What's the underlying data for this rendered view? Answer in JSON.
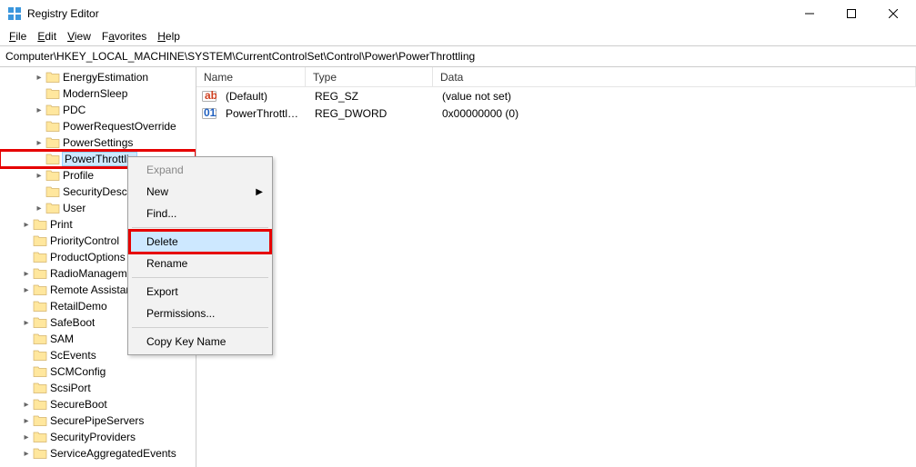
{
  "window": {
    "title": "Registry Editor",
    "icon": "registry-app-icon"
  },
  "menubar": [
    {
      "label": "File",
      "accel": "F"
    },
    {
      "label": "Edit",
      "accel": "E"
    },
    {
      "label": "View",
      "accel": "V"
    },
    {
      "label": "Favorites",
      "accel": "a"
    },
    {
      "label": "Help",
      "accel": "H"
    }
  ],
  "address": "Computer\\HKEY_LOCAL_MACHINE\\SYSTEM\\CurrentControlSet\\Control\\Power\\PowerThrottling",
  "tree": [
    {
      "level": 3,
      "expando": ">",
      "label": "EnergyEstimation"
    },
    {
      "level": 3,
      "expando": "",
      "label": "ModernSleep"
    },
    {
      "level": 3,
      "expando": ">",
      "label": "PDC"
    },
    {
      "level": 3,
      "expando": "",
      "label": "PowerRequestOverride"
    },
    {
      "level": 3,
      "expando": ">",
      "label": "PowerSettings"
    },
    {
      "level": 3,
      "expando": "",
      "label": "PowerThrottlin",
      "selected": true,
      "redbox": true
    },
    {
      "level": 3,
      "expando": ">",
      "label": "Profile"
    },
    {
      "level": 3,
      "expando": "",
      "label": "SecurityDescrip"
    },
    {
      "level": 3,
      "expando": ">",
      "label": "User"
    },
    {
      "level": 2,
      "expando": ">",
      "label": "Print"
    },
    {
      "level": 2,
      "expando": "",
      "label": "PriorityControl"
    },
    {
      "level": 2,
      "expando": "",
      "label": "ProductOptions"
    },
    {
      "level": 2,
      "expando": ">",
      "label": "RadioManagemen"
    },
    {
      "level": 2,
      "expando": ">",
      "label": "Remote Assistance"
    },
    {
      "level": 2,
      "expando": "",
      "label": "RetailDemo"
    },
    {
      "level": 2,
      "expando": ">",
      "label": "SafeBoot"
    },
    {
      "level": 2,
      "expando": "",
      "label": "SAM"
    },
    {
      "level": 2,
      "expando": "",
      "label": "ScEvents"
    },
    {
      "level": 2,
      "expando": "",
      "label": "SCMConfig"
    },
    {
      "level": 2,
      "expando": "",
      "label": "ScsiPort"
    },
    {
      "level": 2,
      "expando": ">",
      "label": "SecureBoot"
    },
    {
      "level": 2,
      "expando": ">",
      "label": "SecurePipeServers"
    },
    {
      "level": 2,
      "expando": ">",
      "label": "SecurityProviders"
    },
    {
      "level": 2,
      "expando": ">",
      "label": "ServiceAggregatedEvents"
    }
  ],
  "values": {
    "columns": {
      "name": "Name",
      "type": "Type",
      "data": "Data"
    },
    "rows": [
      {
        "icon": "string-value-icon",
        "name": "(Default)",
        "type": "REG_SZ",
        "data": "(value not set)"
      },
      {
        "icon": "dword-value-icon",
        "name": "PowerThrottling...",
        "type": "REG_DWORD",
        "data": "0x00000000 (0)"
      }
    ]
  },
  "context_menu": [
    {
      "kind": "item",
      "label": "Expand",
      "disabled": true
    },
    {
      "kind": "item",
      "label": "New",
      "submenu": true
    },
    {
      "kind": "item",
      "label": "Find..."
    },
    {
      "kind": "sep"
    },
    {
      "kind": "item",
      "label": "Delete",
      "hover": true,
      "redbox": true
    },
    {
      "kind": "item",
      "label": "Rename"
    },
    {
      "kind": "sep"
    },
    {
      "kind": "item",
      "label": "Export"
    },
    {
      "kind": "item",
      "label": "Permissions..."
    },
    {
      "kind": "sep"
    },
    {
      "kind": "item",
      "label": "Copy Key Name"
    }
  ]
}
